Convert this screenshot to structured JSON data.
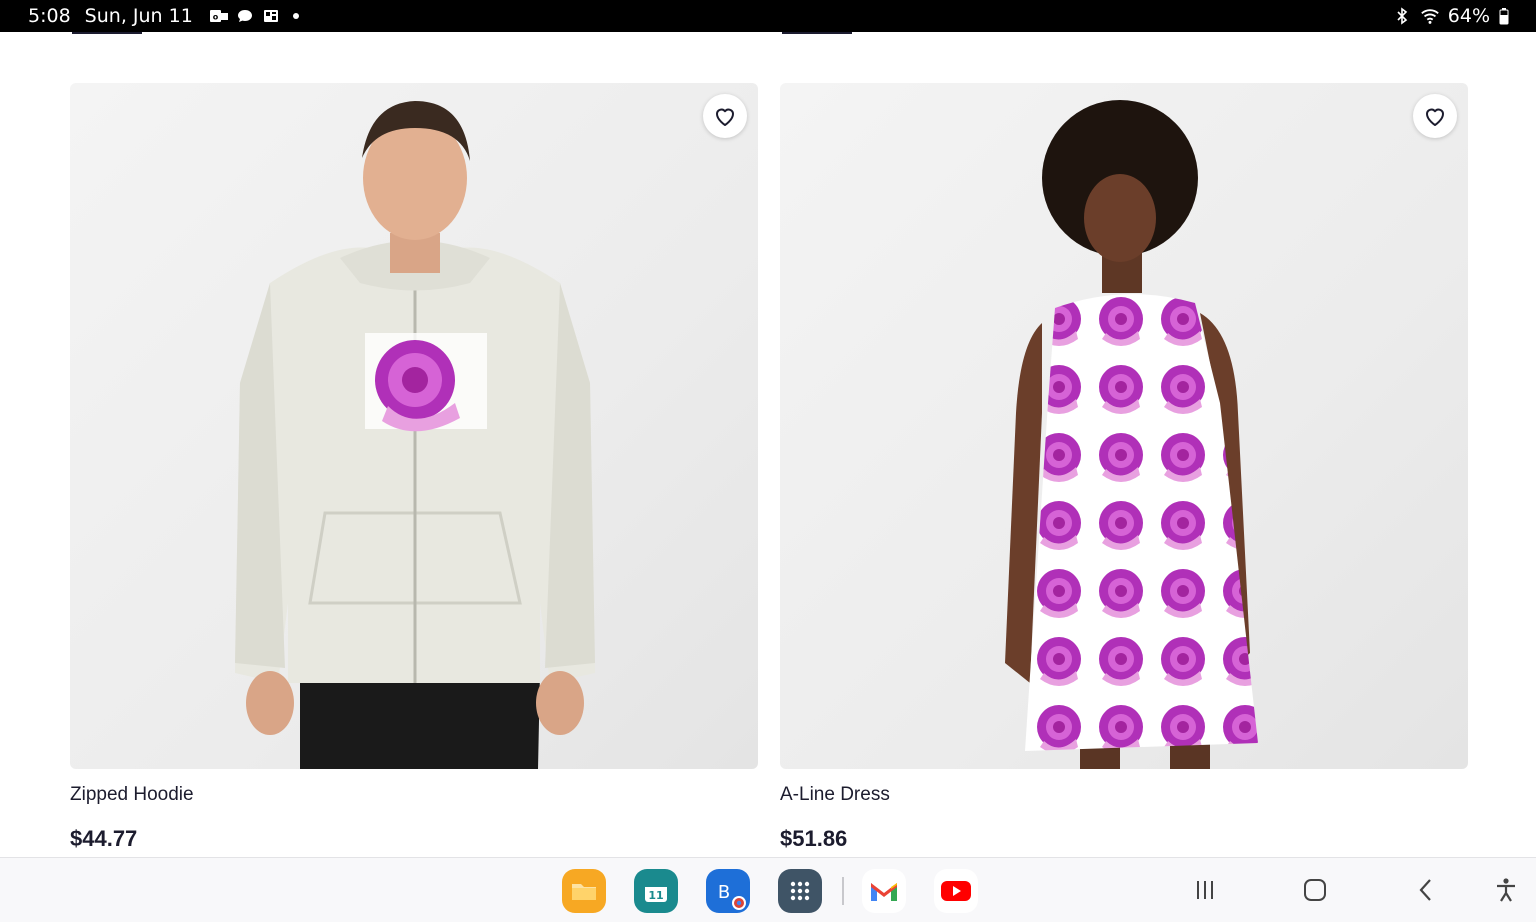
{
  "status_bar": {
    "time": "5:08",
    "date": "Sun, Jun 11",
    "battery": "64%",
    "left_icons": [
      "outlook-icon",
      "chat-icon",
      "gallery-icon",
      "notification-dot"
    ],
    "right_icons": [
      "bluetooth-icon",
      "wifi-icon",
      "battery-icon"
    ]
  },
  "products": [
    {
      "title": "Zipped Hoodie",
      "price": "$44.77",
      "image": "hoodie-image"
    },
    {
      "title": "A-Line Dress",
      "price": "$51.86",
      "image": "dress-image"
    }
  ],
  "colors": {
    "accent_pink": "#b030b8",
    "text_dark": "#1c1c2e",
    "status_bg": "#000000"
  },
  "dock": {
    "apps": [
      "files-app",
      "calendar-app",
      "bing-chrome-app",
      "app-drawer",
      "gmail-app",
      "youtube-app"
    ],
    "calendar_day": "11",
    "bing_letter": "B"
  },
  "nav": [
    "recents-button",
    "home-button",
    "back-button",
    "accessibility-button"
  ]
}
